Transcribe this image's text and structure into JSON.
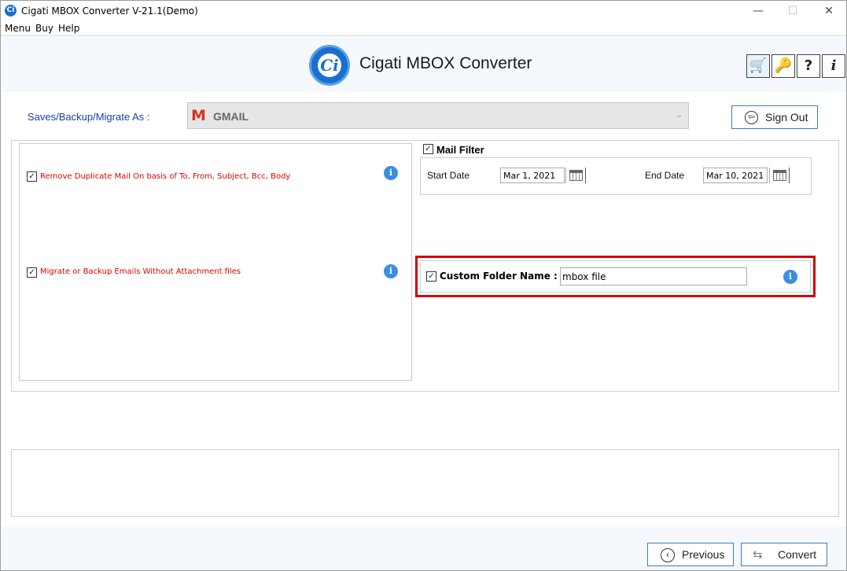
{
  "window": {
    "title": "Cigati MBOX Converter  V-21.1(Demo)",
    "controls": {
      "minimize": "—",
      "maximize": "☐",
      "close": "✕"
    }
  },
  "menubar": {
    "items": [
      "Menu",
      "Buy",
      "Help"
    ]
  },
  "header": {
    "logo_letter": "Ci",
    "title": "Cigati MBOX Converter",
    "icons": [
      "cart-icon",
      "key-icon",
      "help-icon",
      "info-icon"
    ],
    "icon_glyphs": {
      "cart": "🛒",
      "key": "🔑",
      "help": "?",
      "info": "i"
    }
  },
  "saves": {
    "label": "Saves/Backup/Migrate As :",
    "selected": "GMAIL",
    "gmail_glyph": "M",
    "arrow": "⌄",
    "sign_out_label": "Sign Out",
    "sign_out_glyph": "⇦"
  },
  "options": {
    "remove_duplicate": {
      "checked": true,
      "label": "Remove Duplicate Mail On basis of To, From, Subject, Bcc, Body"
    },
    "without_attachment": {
      "checked": true,
      "label": "Migrate or Backup Emails Without Attachment files"
    },
    "check_glyph": "✓",
    "info_glyph": "i"
  },
  "mail_filter": {
    "checked": true,
    "label": "Mail Filter",
    "start_label": "Start Date",
    "start_value": "Mar 1, 2021",
    "end_label": "End Date",
    "end_value": "Mar 10, 2021"
  },
  "custom_folder": {
    "checked": true,
    "label": "Custom Folder Name :",
    "value": "mbox file"
  },
  "footer": {
    "previous_label": "Previous",
    "previous_glyph": "‹",
    "convert_label": "Convert",
    "convert_glyph": "⇆"
  },
  "colors": {
    "accent": "#1b6fd1",
    "label_blue": "#1a3ea8",
    "option_red": "#e00000",
    "highlight_red": "#d40000",
    "button_border": "#3a7cc4"
  }
}
